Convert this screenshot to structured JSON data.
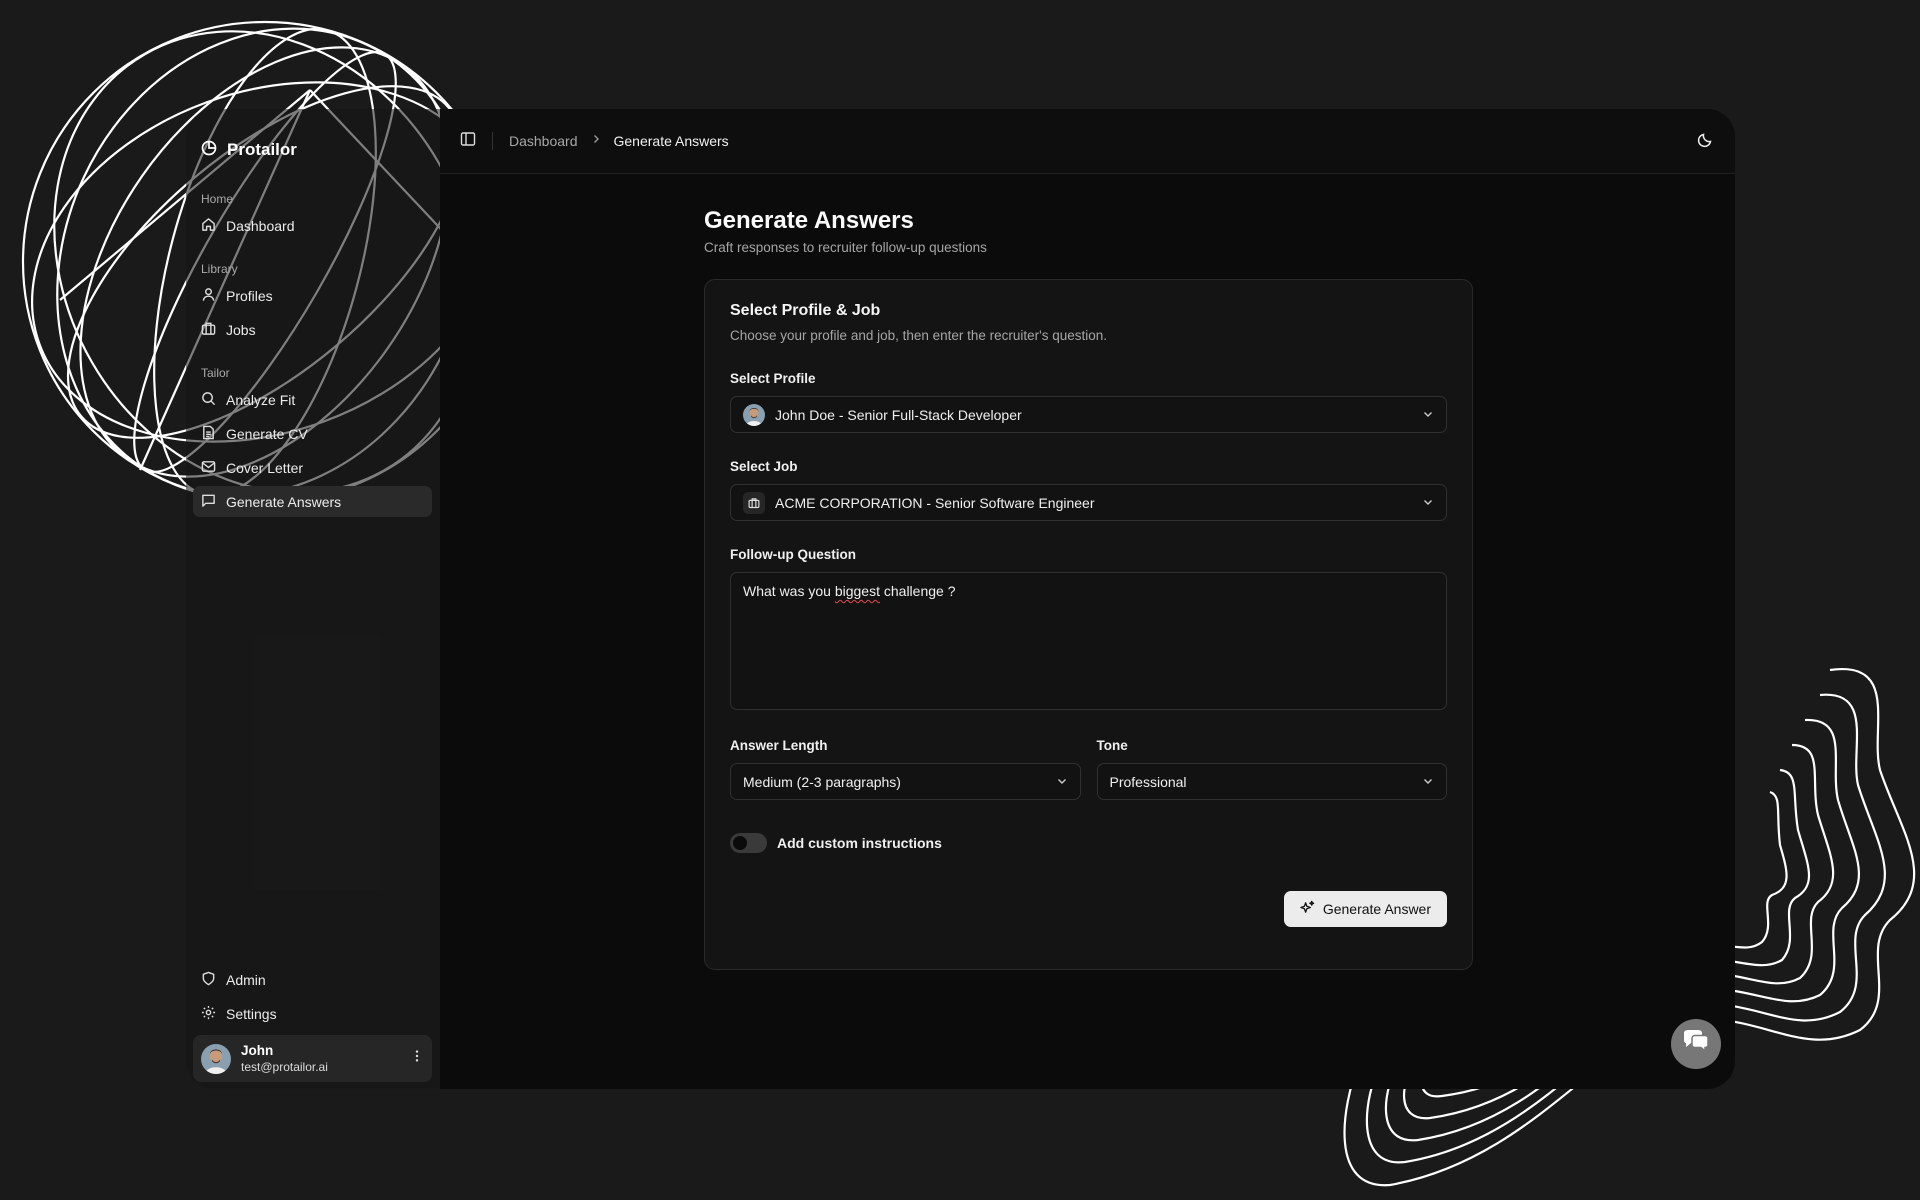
{
  "brand": {
    "name": "Protailor",
    "icon": "pie-chart-icon"
  },
  "sidebar": {
    "groups": [
      {
        "label": "Home",
        "items": [
          {
            "label": "Dashboard",
            "icon": "home-icon"
          }
        ]
      },
      {
        "label": "Library",
        "items": [
          {
            "label": "Profiles",
            "icon": "user-icon"
          },
          {
            "label": "Jobs",
            "icon": "briefcase-icon"
          }
        ]
      },
      {
        "label": "Tailor",
        "items": [
          {
            "label": "Analyze Fit",
            "icon": "search-icon"
          },
          {
            "label": "Generate CV",
            "icon": "file-text-icon"
          },
          {
            "label": "Cover Letter",
            "icon": "mail-icon"
          },
          {
            "label": "Generate Answers",
            "icon": "message-square-icon",
            "active": true
          }
        ]
      }
    ],
    "bottom_items": [
      {
        "label": "Admin",
        "icon": "shield-icon"
      },
      {
        "label": "Settings",
        "icon": "gear-icon"
      }
    ],
    "user": {
      "name": "John",
      "email": "test@protailor.ai"
    }
  },
  "header": {
    "breadcrumb": [
      "Dashboard",
      "Generate Answers"
    ]
  },
  "page": {
    "title": "Generate Answers",
    "subtitle": "Craft responses to recruiter follow-up questions"
  },
  "card": {
    "title": "Select Profile & Job",
    "description": "Choose your profile and job, then enter the recruiter's question.",
    "profile": {
      "label": "Select Profile",
      "value": "John Doe - Senior Full-Stack Developer"
    },
    "job": {
      "label": "Select Job",
      "value": "ACME CORPORATION - Senior Software Engineer"
    },
    "question": {
      "label": "Follow-up Question",
      "value_before": "What was you ",
      "value_misspelled": "biggest",
      "value_after": " challenge ?"
    },
    "answer_length": {
      "label": "Answer Length",
      "value": "Medium (2-3 paragraphs)"
    },
    "tone": {
      "label": "Tone",
      "value": "Professional"
    },
    "custom_toggle": {
      "label": "Add custom instructions",
      "on": false
    },
    "submit": {
      "label": "Generate Answer"
    }
  },
  "colors": {
    "background": "#1a1a1a",
    "main": "#0b0b0b",
    "card": "#141414",
    "button": "#ececec",
    "fab": "#777777"
  }
}
